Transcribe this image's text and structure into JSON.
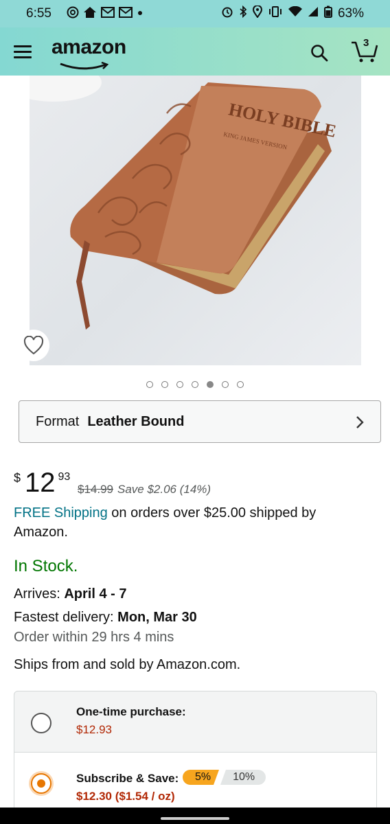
{
  "status_bar": {
    "time": "6:55",
    "battery": "63%",
    "left_icons": [
      "at-sign-icon",
      "home-icon",
      "gmail-icon",
      "gmail-icon",
      "dot-icon"
    ],
    "right_icons": [
      "alarm-icon",
      "bluetooth-icon",
      "location-icon",
      "vibrate-icon",
      "wifi-icon",
      "signal-icon",
      "battery-icon"
    ]
  },
  "header": {
    "logo": "amazon",
    "cart_count": "3"
  },
  "product": {
    "image_alt_text": "HOLY BIBLE",
    "image_subtext": "KING JAMES VERSION",
    "carousel": {
      "total": 7,
      "active_index": 4
    }
  },
  "format": {
    "label": "Format",
    "value": "Leather Bound"
  },
  "price": {
    "symbol": "$",
    "whole": "12",
    "fraction": "93",
    "list_price": "$14.99",
    "savings": "Save $2.06 (14%)"
  },
  "shipping": {
    "link": "FREE Shipping",
    "text": " on orders over $25.00 shipped by Amazon."
  },
  "stock": "In Stock.",
  "delivery": {
    "arrives_label": "Arrives:",
    "arrives_value": "April 4 - 7",
    "fastest_label": "Fastest delivery:",
    "fastest_value": "Mon, Mar 30",
    "order_within": "Order within 29 hrs 4 mins"
  },
  "ships_from": "Ships from and sold by Amazon.com.",
  "purchase_options": {
    "one_time": {
      "title": "One-time purchase:",
      "price": "$12.93",
      "selected": false
    },
    "subscribe": {
      "title": "Subscribe & Save:",
      "price": "$12.30 ($1.54 / oz)",
      "tier_a": "5%",
      "tier_b": "10%",
      "selected": true
    }
  },
  "colors": {
    "header_start": "#84d8d2",
    "header_end": "#a6e4c3",
    "link": "#007185",
    "in_stock": "#007600",
    "price_red": "#b12704",
    "accent_orange": "#e77600"
  }
}
